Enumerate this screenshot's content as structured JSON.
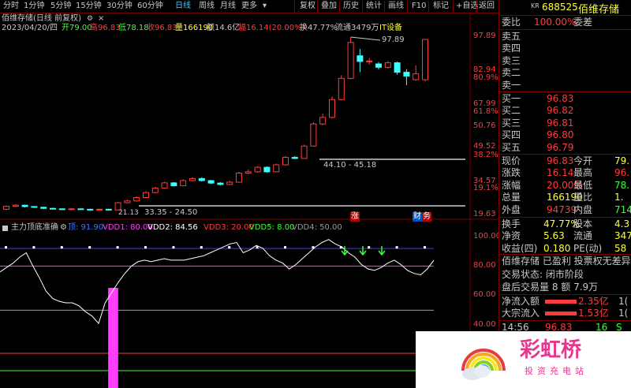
{
  "toolbar": {
    "periods": [
      "分时",
      "1分钟",
      "5分钟",
      "15分钟",
      "30分钟",
      "60分钟",
      "日线",
      "周线",
      "月线",
      "更多"
    ],
    "active_period": "日线",
    "settings_icon": "gear-icon",
    "close_icon": "close-icon",
    "actions": [
      "复权",
      "叠加",
      "历史",
      "统计",
      "画线",
      "F10",
      "标记",
      "+自选",
      "返回"
    ]
  },
  "chart_header": {
    "title": "佰维存储(日线 前复权)",
    "date": "2023/04/20/四",
    "open": "开79.00",
    "high": "高96.83",
    "low": "低78.18",
    "close": "收96.83",
    "volume": "量166190",
    "amount": "额14.6亿",
    "change": "幅16.14(20.00%)",
    "turnover": "换47.77%",
    "float": "流通3479万",
    "it_tag": "IT设备"
  },
  "price_axis": {
    "labels": [
      "97.89",
      "82.94",
      "80.9%",
      "67.99",
      "61.8%",
      "50.76",
      "49.52",
      "38.2%",
      "34.57",
      "19.1%",
      "19.63"
    ],
    "colors": [
      "#ff3c3c",
      "#ff3c3c",
      "#ff3c3c",
      "#ff3c3c",
      "#ff3c3c",
      "#ff3c3c",
      "#ff3c3c",
      "#ff3c3c",
      "#ff3c3c",
      "#ff3c3c",
      "#ff3c3c"
    ]
  },
  "annotations": {
    "high_marker": "97.89",
    "range1": "44.10 - 45.18",
    "range2": "33.35 - 24.50",
    "low_marker": "21.13",
    "badge_zhang": "涨",
    "badge_cai": "财",
    "badge_bao": "务"
  },
  "candles": [
    {
      "o": 21.6,
      "c": 22.9,
      "h": 23.3,
      "l": 21.3
    },
    {
      "o": 22.9,
      "c": 23.4,
      "h": 23.9,
      "l": 22.6
    },
    {
      "o": 23.4,
      "c": 22.8,
      "h": 23.6,
      "l": 22.4
    },
    {
      "o": 22.8,
      "c": 22.5,
      "h": 23.0,
      "l": 22.2
    },
    {
      "o": 22.5,
      "c": 22.0,
      "h": 22.7,
      "l": 21.7
    },
    {
      "o": 22.0,
      "c": 21.8,
      "h": 22.3,
      "l": 21.5
    },
    {
      "o": 21.8,
      "c": 21.5,
      "h": 22.0,
      "l": 21.2
    },
    {
      "o": 21.5,
      "c": 21.8,
      "h": 22.1,
      "l": 21.3
    },
    {
      "o": 21.8,
      "c": 21.6,
      "h": 22.0,
      "l": 21.4
    },
    {
      "o": 21.6,
      "c": 21.3,
      "h": 21.8,
      "l": 21.1
    },
    {
      "o": 21.3,
      "c": 21.6,
      "h": 21.9,
      "l": 21.2
    },
    {
      "o": 21.6,
      "c": 21.3,
      "h": 21.8,
      "l": 21.13
    },
    {
      "o": 21.3,
      "c": 24.5,
      "h": 25.0,
      "l": 21.2
    },
    {
      "o": 24.5,
      "c": 25.3,
      "h": 26.0,
      "l": 24.2
    },
    {
      "o": 25.3,
      "c": 26.8,
      "h": 27.3,
      "l": 25.0
    },
    {
      "o": 26.8,
      "c": 29.0,
      "h": 29.6,
      "l": 26.5
    },
    {
      "o": 29.0,
      "c": 31.0,
      "h": 31.5,
      "l": 28.7
    },
    {
      "o": 31.0,
      "c": 33.3,
      "h": 33.8,
      "l": 30.7
    },
    {
      "o": 33.3,
      "c": 32.0,
      "h": 33.6,
      "l": 31.7
    },
    {
      "o": 32.0,
      "c": 34.3,
      "h": 34.9,
      "l": 31.8
    },
    {
      "o": 34.3,
      "c": 35.2,
      "h": 35.8,
      "l": 33.9
    },
    {
      "o": 35.2,
      "c": 34.3,
      "h": 35.8,
      "l": 33.9
    },
    {
      "o": 34.3,
      "c": 33.2,
      "h": 34.6,
      "l": 32.8
    },
    {
      "o": 33.2,
      "c": 32.6,
      "h": 33.6,
      "l": 32.2
    },
    {
      "o": 32.6,
      "c": 33.6,
      "h": 34.2,
      "l": 32.3
    },
    {
      "o": 33.6,
      "c": 37.6,
      "h": 38.2,
      "l": 33.4
    },
    {
      "o": 37.6,
      "c": 38.2,
      "h": 39.2,
      "l": 37.0
    },
    {
      "o": 38.2,
      "c": 40.2,
      "h": 40.8,
      "l": 37.8
    },
    {
      "o": 40.2,
      "c": 38.2,
      "h": 40.6,
      "l": 37.8
    },
    {
      "o": 38.2,
      "c": 41.3,
      "h": 41.9,
      "l": 38.0
    },
    {
      "o": 41.3,
      "c": 44.6,
      "h": 45.2,
      "l": 41.0
    },
    {
      "o": 44.6,
      "c": 44.1,
      "h": 45.18,
      "l": 43.8
    },
    {
      "o": 44.1,
      "c": 49.6,
      "h": 50.3,
      "l": 44.0
    },
    {
      "o": 49.6,
      "c": 59.4,
      "h": 60.2,
      "l": 49.3
    },
    {
      "o": 59.4,
      "c": 62.3,
      "h": 64.0,
      "l": 58.8
    },
    {
      "o": 62.3,
      "c": 70.2,
      "h": 71.6,
      "l": 61.8
    },
    {
      "o": 70.2,
      "c": 79.6,
      "h": 81.0,
      "l": 69.8
    },
    {
      "o": 79.6,
      "c": 95.5,
      "h": 97.89,
      "l": 79.2
    },
    {
      "o": 89.6,
      "c": 87.1,
      "h": 92.6,
      "l": 82.4
    },
    {
      "o": 87.1,
      "c": 87.3,
      "h": 88.6,
      "l": 85.6
    },
    {
      "o": 86.0,
      "c": 84.5,
      "h": 86.8,
      "l": 83.6
    },
    {
      "o": 84.5,
      "c": 86.5,
      "h": 87.3,
      "l": 83.9
    },
    {
      "o": 86.5,
      "c": 82.3,
      "h": 87.0,
      "l": 81.2
    },
    {
      "o": 82.3,
      "c": 80.6,
      "h": 83.7,
      "l": 76.6
    },
    {
      "o": 79.0,
      "c": 81.6,
      "h": 85.4,
      "l": 78.5
    },
    {
      "o": 79.0,
      "c": 96.83,
      "h": 96.83,
      "l": 78.18
    }
  ],
  "indicator": {
    "name": "主力顶底准确",
    "labels": [
      {
        "text": "顶: 91.90",
        "color": "#3c7cff"
      },
      {
        "text": "VDD1: 80.00",
        "color": "#ff3cff"
      },
      {
        "text": "VDD2: 84.56",
        "color": "#ffffff"
      },
      {
        "text": "VDD3: 20.00",
        "color": "#ff3c3c"
      },
      {
        "text": "VDD5: 8.00",
        "color": "#3cff3c"
      },
      {
        "text": "VDD4: 50.00",
        "color": "#9a9a9a"
      }
    ],
    "axis_labels": [
      "100.00",
      "80.00",
      "60.00",
      "40.00"
    ],
    "line": [
      76,
      79,
      82,
      86,
      89,
      80,
      72,
      63,
      58,
      56,
      55,
      55,
      53,
      49,
      46,
      41,
      55,
      62,
      69,
      75,
      80,
      83,
      84,
      83,
      84,
      85,
      84,
      84,
      84,
      85,
      86,
      87,
      89,
      91,
      93,
      95,
      96,
      89,
      91,
      94,
      92,
      87,
      84,
      82,
      78,
      81,
      85,
      89,
      93,
      96,
      98,
      95,
      93,
      89,
      86,
      81,
      78,
      77,
      79,
      82,
      84,
      81,
      77,
      75,
      74,
      78,
      84
    ],
    "pink_bars": [
      13,
      14
    ],
    "arrows": [
      55,
      58,
      61
    ],
    "top_dots_color": "#ffffff",
    "top_line": 91.9,
    "vdd1": 80,
    "vdd4": 50,
    "vdd3": 20,
    "vdd5": 8
  },
  "right_panel": {
    "code": "688525",
    "name": "佰维存储",
    "weibi_label": "委比",
    "weibi_value": "100.00%",
    "weicha_label": "委差",
    "weicha_value": "",
    "sell_labels": [
      "卖五",
      "卖四",
      "卖三",
      "卖二",
      "卖一"
    ],
    "buy_rows": [
      {
        "label": "买一",
        "price": "96.83"
      },
      {
        "label": "买二",
        "price": "96.82"
      },
      {
        "label": "买三",
        "price": "96.81"
      },
      {
        "label": "买四",
        "price": "96.80"
      },
      {
        "label": "买五",
        "price": "96.79"
      }
    ],
    "stats": [
      {
        "l1": "现价",
        "v1": "96.83",
        "l2": "今开",
        "v2": "79."
      },
      {
        "l1": "涨跌",
        "v1": "16.14",
        "l2": "最高",
        "v2": "96."
      },
      {
        "l1": "涨幅",
        "v1": "20.00%",
        "l2": "最低",
        "v2": "78."
      },
      {
        "l1": "总量",
        "v1": "166190",
        "l2": "量比",
        "v2": "1."
      },
      {
        "l1": "外盘",
        "v1": "94739",
        "l2": "内盘",
        "v2": "714"
      }
    ],
    "stats2": [
      {
        "l1": "换手",
        "v1": "47.77%",
        "l2": "股本",
        "v2": "4.3"
      },
      {
        "l1": "净资",
        "v1": "5.63",
        "l2": "流通",
        "v2": "347"
      },
      {
        "l1": "收益(四)",
        "v1": "0.180",
        "l2": "PE(动)",
        "v2": "58"
      }
    ],
    "info_line": "佰维存储 已盈利 投票权无差异",
    "trade_status": "交易状态: 闭市阶段",
    "after_hours": "盘后交易量 8 额 7.9万",
    "flows": [
      {
        "label": "净流入额",
        "value": "2.35亿",
        "tail": "1("
      },
      {
        "label": "大宗流入",
        "value": "1.53亿",
        "tail": "1("
      }
    ],
    "tick_time": "14:56",
    "tick_price": "96.83",
    "tick_vol": "16",
    "tick_flag": "S"
  },
  "logo": {
    "title": "彩虹桥",
    "subtitle": "投资充电站"
  }
}
